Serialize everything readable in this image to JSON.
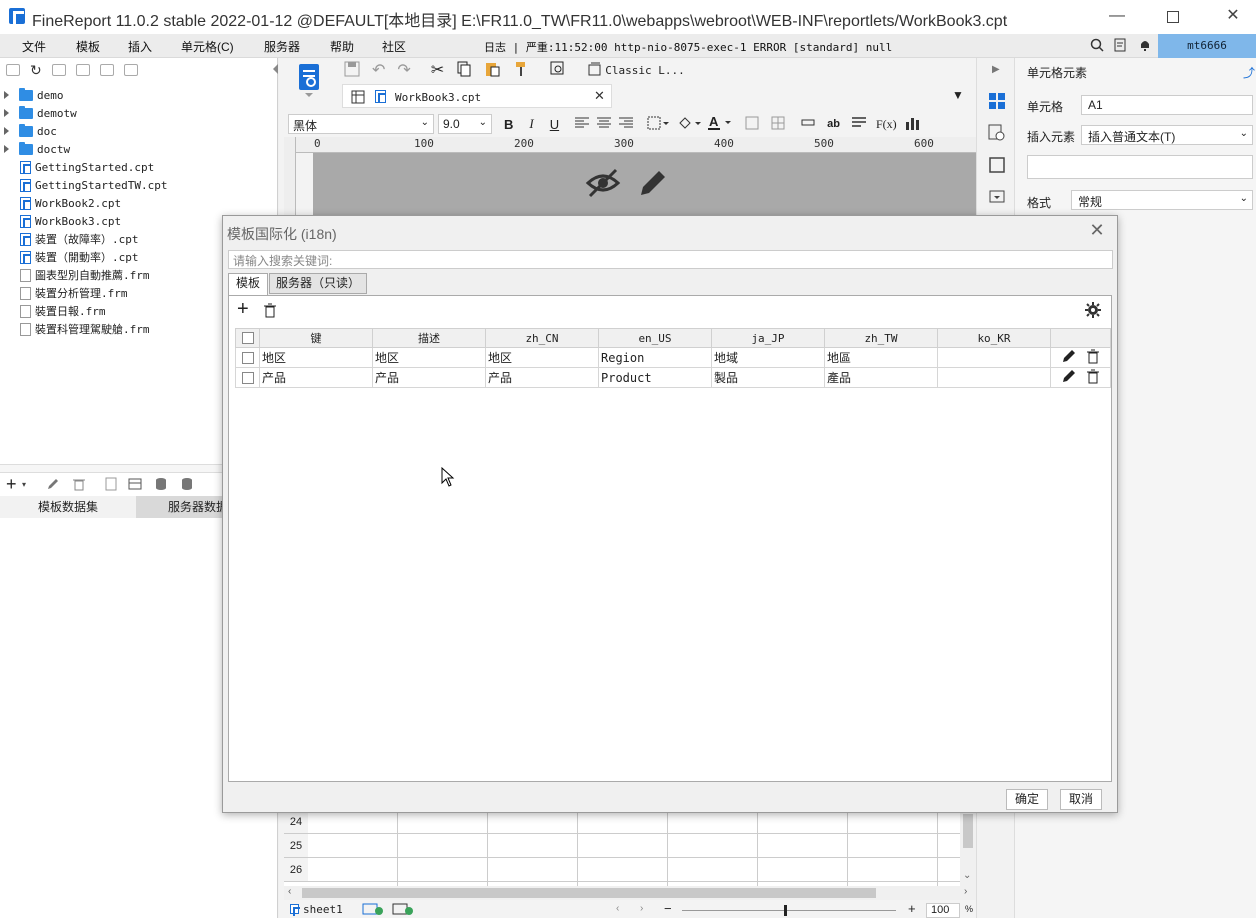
{
  "window": {
    "title": "FineReport 11.0.2 stable 2022-01-12 @DEFAULT[本地目录]   E:\\FR11.0_TW\\FR11.0\\webapps\\webroot\\WEB-INF\\reportlets/WorkBook3.cpt"
  },
  "menu": {
    "items": [
      "文件",
      "模板",
      "插入",
      "单元格(C)",
      "服务器",
      "帮助",
      "社区"
    ],
    "log_text": "日志 | 严重:11:52:00 http-nio-8075-exec-1 ERROR [standard] null",
    "user": "mt6666"
  },
  "tree": {
    "items": [
      {
        "name": "demo",
        "type": "folder"
      },
      {
        "name": "demotw",
        "type": "folder"
      },
      {
        "name": "doc",
        "type": "folder"
      },
      {
        "name": "doctw",
        "type": "folder"
      },
      {
        "name": "GettingStarted.cpt",
        "type": "cpt"
      },
      {
        "name": "GettingStartedTW.cpt",
        "type": "cpt"
      },
      {
        "name": "WorkBook2.cpt",
        "type": "cpt"
      },
      {
        "name": "WorkBook3.cpt",
        "type": "cpt"
      },
      {
        "name": "装置（故障率）.cpt",
        "type": "cpt"
      },
      {
        "name": "裝置（開動率）.cpt",
        "type": "cpt"
      },
      {
        "name": "圖表型別自動推薦.frm",
        "type": "frm"
      },
      {
        "name": "裝置分析管理.frm",
        "type": "frm"
      },
      {
        "name": "裝置日報.frm",
        "type": "frm"
      },
      {
        "name": "裝置科管理駕駛艙.frm",
        "type": "frm"
      }
    ]
  },
  "dataset": {
    "tab_template": "模板数据集",
    "tab_server": "服务器数据"
  },
  "editor": {
    "style_name": "Classic L...",
    "file_tab": "WorkBook3.cpt",
    "font_name": "黑体",
    "font_size": "9.0",
    "ruler_ticks": [
      "0",
      "100",
      "200",
      "300",
      "400",
      "500",
      "600"
    ],
    "row_numbers": [
      "24",
      "25",
      "26"
    ],
    "sheet_tab": "sheet1",
    "zoom_value": "100",
    "zoom_unit": "%"
  },
  "right_panel": {
    "header": "单元格元素",
    "cell_label": "单元格",
    "cell_value": "A1",
    "insert_label": "插入元素",
    "insert_value": "插入普通文本(T)",
    "format_label": "格式",
    "format_value": "常规"
  },
  "dialog": {
    "title": "模板国际化 (i18n)",
    "search_placeholder": "请输入搜索关键词:",
    "tabs": [
      "模板",
      "服务器（只读）"
    ],
    "columns": [
      "键",
      "描述",
      "zh_CN",
      "en_US",
      "ja_JP",
      "zh_TW",
      "ko_KR"
    ],
    "rows": [
      [
        "地区",
        "地区",
        "地区",
        "Region",
        "地域",
        "地區",
        ""
      ],
      [
        "产品",
        "产品",
        "产品",
        "Product",
        "製品",
        "產品",
        ""
      ]
    ],
    "ok_label": "确定",
    "cancel_label": "取消"
  },
  "colors": {
    "accent": "#1a6fd6",
    "user_badge": "#7fb7ea",
    "canvas_gray": "#a9a9a9"
  }
}
